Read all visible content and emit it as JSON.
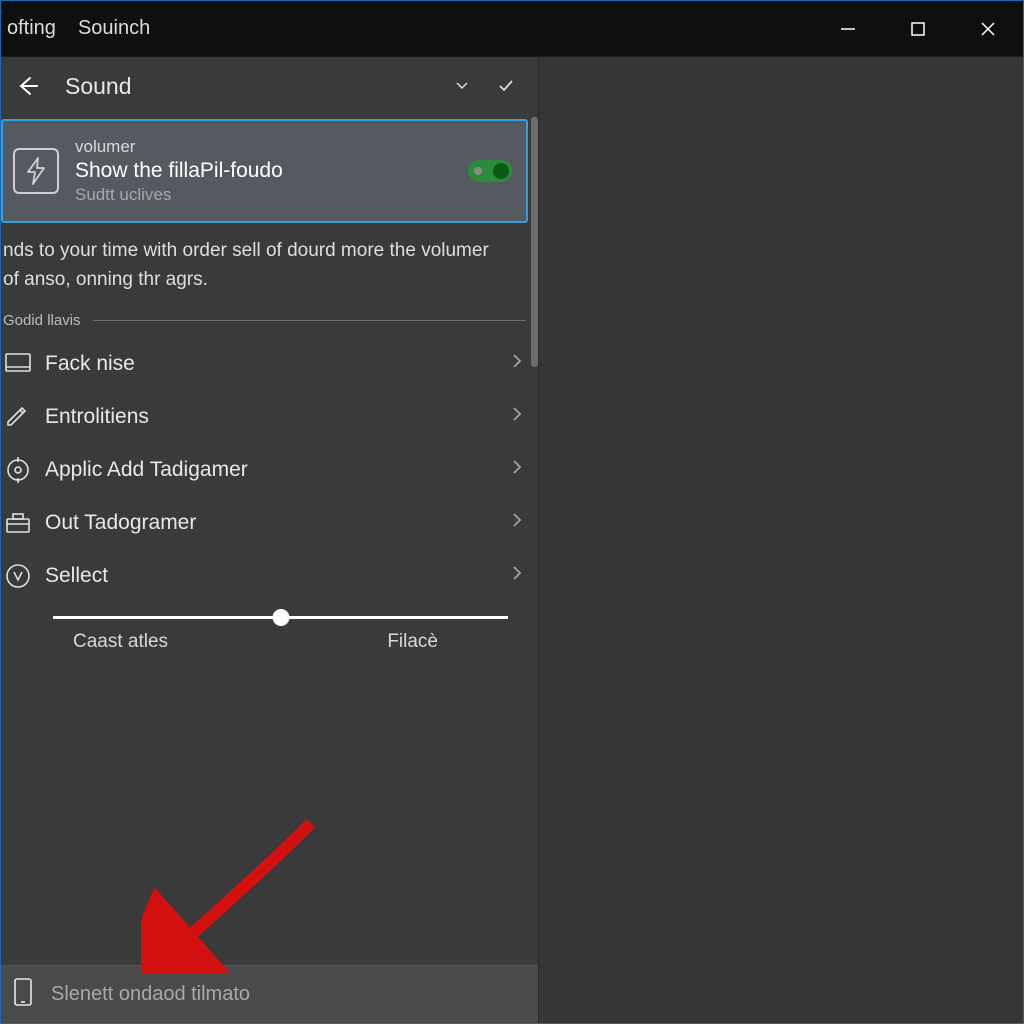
{
  "titlebar": {
    "menu1": "ofting",
    "menu2": "Souinch"
  },
  "header": {
    "title": "Sound"
  },
  "card": {
    "sub": "volumer",
    "label": "Show the fillaPil-foudo",
    "desc": "Sudtt uclives"
  },
  "description": "nds to your time with order sell of dourd more the volumer of anso, onning thr agrs.",
  "section_label": "Godid llavis",
  "items": [
    {
      "label": "Fack nise"
    },
    {
      "label": "Entrolitiens"
    },
    {
      "label": "Applic Add Tadigamer"
    },
    {
      "label": "Out Tadogramer"
    },
    {
      "label": "Sellect"
    }
  ],
  "slider": {
    "left": "Caast atles",
    "right": "Filacè",
    "value": 50
  },
  "bottom": {
    "label": "Slenett ondaod tilmato"
  }
}
